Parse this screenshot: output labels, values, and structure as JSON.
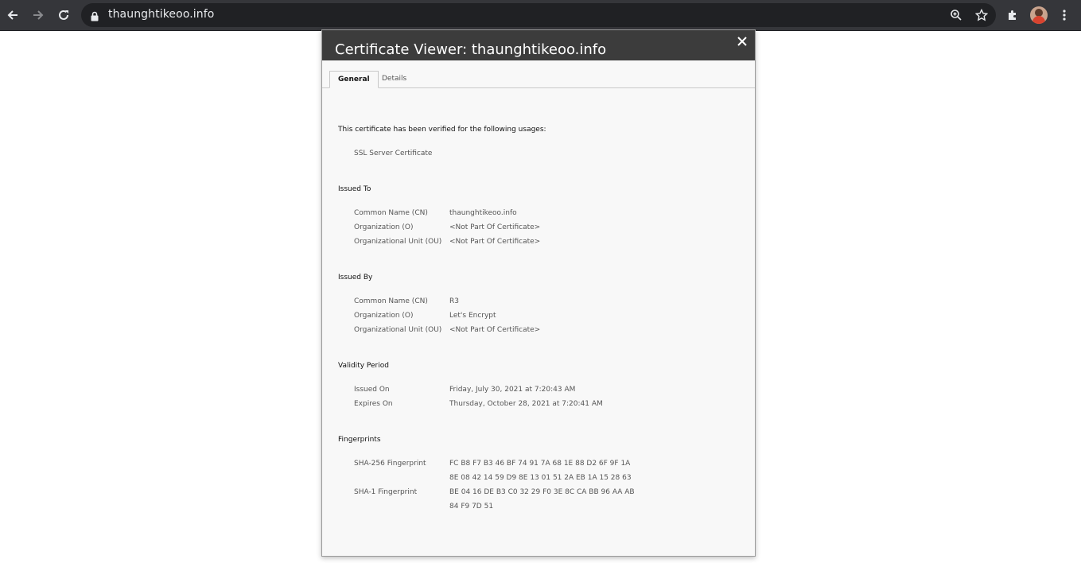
{
  "browser": {
    "url": "thaunghtikeoo.info",
    "icons": [
      "back-arrow-icon",
      "forward-arrow-icon",
      "reload-icon",
      "lock-icon",
      "zoom-icon",
      "star-icon",
      "extensions-icon",
      "avatar",
      "kebab-menu-icon"
    ]
  },
  "dialog": {
    "title": "Certificate Viewer: thaunghtikeoo.info",
    "close_glyph": "×",
    "tabs": [
      {
        "label": "General",
        "active": true
      },
      {
        "label": "Details",
        "active": false
      }
    ],
    "verified_heading": "This certificate has been verified for the following usages:",
    "usage": "SSL Server Certificate",
    "issued_to": {
      "heading": "Issued To",
      "rows": [
        {
          "label": "Common Name (CN)",
          "value": "thaunghtikeoo.info"
        },
        {
          "label": "Organization (O)",
          "value": "<Not Part Of Certificate>"
        },
        {
          "label": "Organizational Unit (OU)",
          "value": "<Not Part Of Certificate>"
        }
      ]
    },
    "issued_by": {
      "heading": "Issued By",
      "rows": [
        {
          "label": "Common Name (CN)",
          "value": "R3"
        },
        {
          "label": "Organization (O)",
          "value": "Let's Encrypt"
        },
        {
          "label": "Organizational Unit (OU)",
          "value": "<Not Part Of Certificate>"
        }
      ]
    },
    "validity": {
      "heading": "Validity Period",
      "rows": [
        {
          "label": "Issued On",
          "value": "Friday, July 30, 2021 at 7:20:43 AM"
        },
        {
          "label": "Expires On",
          "value": "Thursday, October 28, 2021 at 7:20:41 AM"
        }
      ]
    },
    "fingerprints": {
      "heading": "Fingerprints",
      "sha256_label": "SHA-256 Fingerprint",
      "sha256_line1": "FC B8 F7 B3 46 BF 74 91 7A 68 1E 88 D2 6F 9F 1A",
      "sha256_line2": "8E 08 42 14 59 D9 8E 13 01 51 2A EB 1A 15 28 63",
      "sha1_label": "SHA-1 Fingerprint",
      "sha1_line1": "BE 04 16 DE B3 C0 32 29 F0 3E 8C CA BB 96 AA AB",
      "sha1_line2": "84 F9 7D 51"
    }
  }
}
